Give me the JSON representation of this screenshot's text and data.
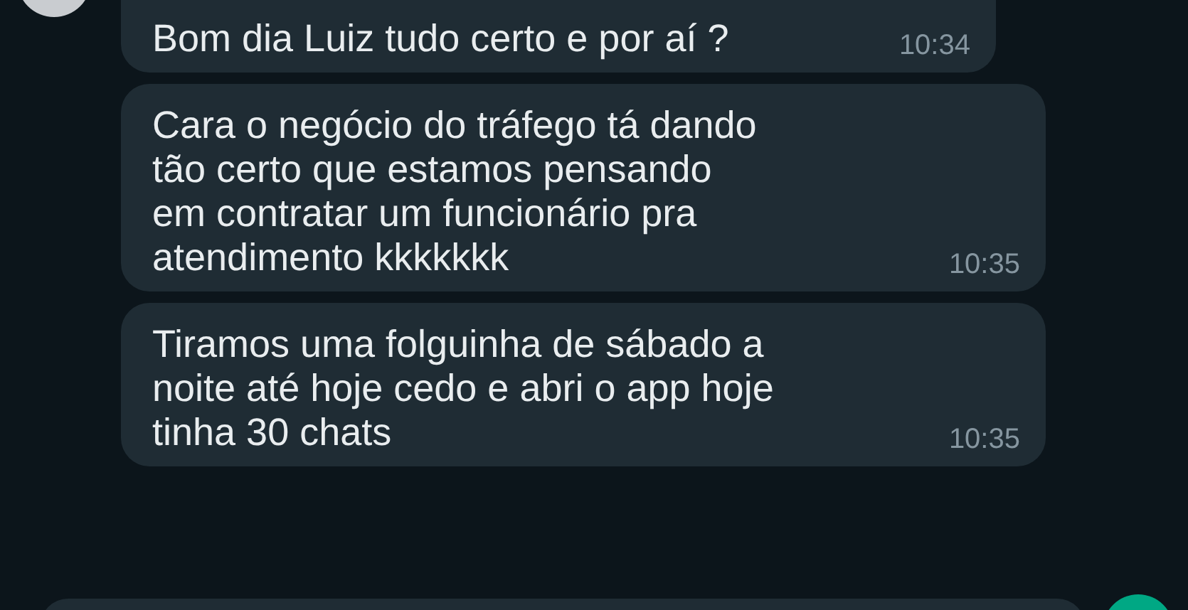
{
  "messages": [
    {
      "text": "Bom dia Luiz tudo certo e por aí ?",
      "time": "10:34"
    },
    {
      "text": "Cara o negócio do tráfego tá dando\ntão certo que estamos pensando\nem contratar um funcionário pra\natendimento kkkkkkk",
      "time": "10:35"
    },
    {
      "text": "Tiramos uma folguinha de sábado a\nnoite até hoje cedo e abri o app hoje\ntinha 30 chats",
      "time": "10:35"
    }
  ]
}
